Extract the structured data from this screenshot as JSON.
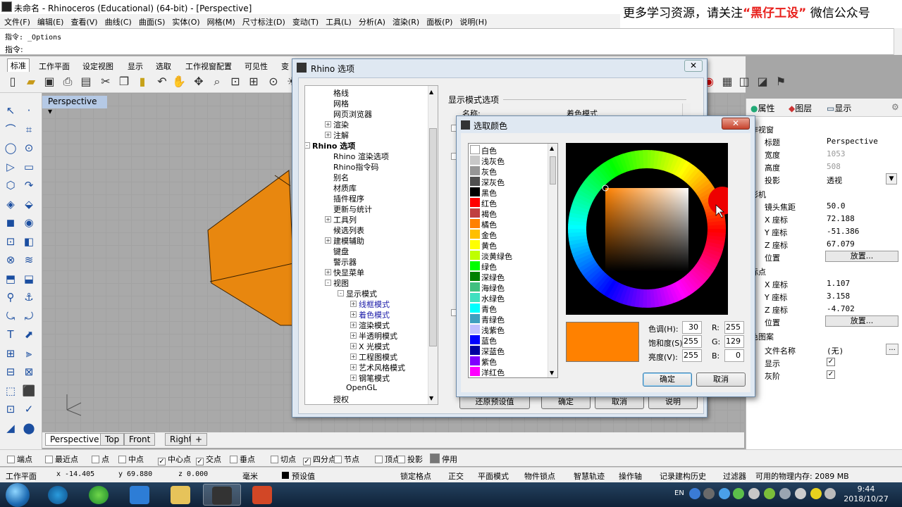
{
  "title_bar": {
    "title": "未命名 - Rhinoceros (Educational) (64-bit) - [Perspective]"
  },
  "banner": {
    "prefix": "更多学习资源，请关注",
    "highlight": "“黑仔工设”",
    "suffix": "微信公众号"
  },
  "menu": [
    "文件(F)",
    "编辑(E)",
    "查看(V)",
    "曲线(C)",
    "曲面(S)",
    "实体(O)",
    "网格(M)",
    "尺寸标注(D)",
    "变动(T)",
    "工具(L)",
    "分析(A)",
    "渲染(R)",
    "面板(P)",
    "说明(H)"
  ],
  "command": {
    "history": "指令: _Options",
    "prompt": "指令:"
  },
  "toolbar_tabs": [
    "标准",
    "工作平面",
    "设定视图",
    "显示",
    "选取",
    "工作视窗配置",
    "可见性",
    "变"
  ],
  "viewport": {
    "label": "Perspective"
  },
  "view_tabs": [
    "Perspective",
    "Top",
    "Front",
    "Right",
    "+"
  ],
  "osnaps": [
    {
      "label": "端点",
      "checked": false
    },
    {
      "label": "最近点",
      "checked": false
    },
    {
      "label": "点",
      "checked": false
    },
    {
      "label": "中点",
      "checked": false
    },
    {
      "label": "中心点",
      "checked": true
    },
    {
      "label": "交点",
      "checked": true
    },
    {
      "label": "垂点",
      "checked": false
    },
    {
      "label": "切点",
      "checked": false
    },
    {
      "label": "四分点",
      "checked": true
    },
    {
      "label": "节点",
      "checked": false
    },
    {
      "label": "顶点",
      "checked": false
    },
    {
      "label": "投影",
      "checked": false
    },
    {
      "label": "停用",
      "checked": false
    }
  ],
  "status": {
    "cplane": "工作平面",
    "x": "x -14.405",
    "y": "y 69.880",
    "z": "z 0.000",
    "unit": "毫米",
    "layer": "预设值",
    "items": [
      "锁定格点",
      "正交",
      "平面模式",
      "物件锁点",
      "智慧轨迹",
      "操作轴",
      "记录建构历史",
      "过滤器"
    ],
    "memory": "可用的物理内存: 2089 MB"
  },
  "taskbar": {
    "time": "9:44",
    "date": "2018/10/27",
    "lang": "EN"
  },
  "right_panel": {
    "tabs": [
      "属性",
      "图层",
      "显示"
    ],
    "rows": [
      {
        "type": "sec",
        "k": "作视窗"
      },
      {
        "k": "标题",
        "v": "Perspective"
      },
      {
        "k": "宽度",
        "v": "1053",
        "dim": true
      },
      {
        "k": "高度",
        "v": "508",
        "dim": true
      },
      {
        "k": "投影",
        "v": "透视",
        "dropdown": true
      },
      {
        "type": "sec",
        "k": "影机"
      },
      {
        "k": "镜头焦距",
        "v": "50.0"
      },
      {
        "k": "X 座标",
        "v": "72.188"
      },
      {
        "k": "Y 座标",
        "v": "-51.386"
      },
      {
        "k": "Z 座标",
        "v": "67.079"
      },
      {
        "k": "位置",
        "btn": "放置..."
      },
      {
        "type": "sec",
        "k": "标点"
      },
      {
        "k": "X 座标",
        "v": "1.107"
      },
      {
        "k": "Y 座标",
        "v": "3.158"
      },
      {
        "k": "Z 座标",
        "v": "-4.702"
      },
      {
        "k": "位置",
        "btn": "放置..."
      },
      {
        "type": "sec",
        "k": "色图案"
      },
      {
        "k": "文件名称",
        "v": "(无)"
      },
      {
        "k": "显示",
        "check": true
      },
      {
        "k": "灰阶",
        "check": true
      }
    ]
  },
  "options_dialog": {
    "title": "Rhino 选项",
    "section_label": "显示模式选项",
    "name_label": "名称:",
    "name_value": "着色模式",
    "bottom_buttons": [
      "还原预设值",
      "确定",
      "取消",
      "说明"
    ],
    "tree": [
      {
        "label": "格线",
        "indent": 2
      },
      {
        "label": "网格",
        "indent": 2
      },
      {
        "label": "网页浏览器",
        "indent": 2
      },
      {
        "label": "渲染",
        "indent": 2,
        "exp": "+"
      },
      {
        "label": "注解",
        "indent": 2,
        "exp": "+"
      },
      {
        "label": "Rhino 选项",
        "indent": 1,
        "exp": "-",
        "bold": true
      },
      {
        "label": "Rhino 渲染选项",
        "indent": 2
      },
      {
        "label": "Rhino指令码",
        "indent": 2
      },
      {
        "label": "别名",
        "indent": 2
      },
      {
        "label": "材质库",
        "indent": 2
      },
      {
        "label": "插件程序",
        "indent": 2
      },
      {
        "label": "更新与统计",
        "indent": 2
      },
      {
        "label": "工具列",
        "indent": 2,
        "exp": "+"
      },
      {
        "label": "候选列表",
        "indent": 2
      },
      {
        "label": "建模辅助",
        "indent": 2,
        "exp": "+"
      },
      {
        "label": "键盘",
        "indent": 2
      },
      {
        "label": "警示器",
        "indent": 2
      },
      {
        "label": "快显菜单",
        "indent": 2,
        "exp": "+"
      },
      {
        "label": "视图",
        "indent": 2,
        "exp": "-"
      },
      {
        "label": "显示模式",
        "indent": 3,
        "exp": "-"
      },
      {
        "label": "线框模式",
        "indent": 4,
        "exp": "+",
        "sel": true
      },
      {
        "label": "着色模式",
        "indent": 4,
        "exp": "+",
        "sel": true
      },
      {
        "label": "渲染模式",
        "indent": 4,
        "exp": "+"
      },
      {
        "label": "半透明模式",
        "indent": 4,
        "exp": "+"
      },
      {
        "label": "X 光模式",
        "indent": 4,
        "exp": "+"
      },
      {
        "label": "工程图模式",
        "indent": 4,
        "exp": "+"
      },
      {
        "label": "艺术风格模式",
        "indent": 4,
        "exp": "+"
      },
      {
        "label": "钢笔模式",
        "indent": 4,
        "exp": "+"
      },
      {
        "label": "OpenGL",
        "indent": 3
      },
      {
        "label": "授权",
        "indent": 2
      }
    ]
  },
  "color_dialog": {
    "title": "选取颜色",
    "colors": [
      {
        "name": "白色",
        "hex": "#ffffff"
      },
      {
        "name": "浅灰色",
        "hex": "#c8c8c8"
      },
      {
        "name": "灰色",
        "hex": "#969696"
      },
      {
        "name": "深灰色",
        "hex": "#505050"
      },
      {
        "name": "黑色",
        "hex": "#000000"
      },
      {
        "name": "红色",
        "hex": "#ff0000"
      },
      {
        "name": "褐色",
        "hex": "#c04040"
      },
      {
        "name": "橘色",
        "hex": "#ff8000"
      },
      {
        "name": "金色",
        "hex": "#ffbf00"
      },
      {
        "name": "黄色",
        "hex": "#ffff00"
      },
      {
        "name": "淡黄绿色",
        "hex": "#bfff00"
      },
      {
        "name": "绿色",
        "hex": "#00ff00"
      },
      {
        "name": "深绿色",
        "hex": "#008000"
      },
      {
        "name": "海绿色",
        "hex": "#40c080"
      },
      {
        "name": "水绿色",
        "hex": "#40e0c0"
      },
      {
        "name": "青色",
        "hex": "#00ffff"
      },
      {
        "name": "青绿色",
        "hex": "#40a0c0"
      },
      {
        "name": "浅紫色",
        "hex": "#c0c0ff"
      },
      {
        "name": "蓝色",
        "hex": "#0000ff"
      },
      {
        "name": "深蓝色",
        "hex": "#0000a0"
      },
      {
        "name": "紫色",
        "hex": "#8000ff"
      },
      {
        "name": "洋红色",
        "hex": "#ff00ff"
      }
    ],
    "hue_label": "色调(H):",
    "hue": "30",
    "sat_label": "饱和度(S):",
    "sat": "255",
    "val_label": "亮度(V):",
    "val": "255",
    "r_label": "R:",
    "r": "255",
    "g_label": "G:",
    "g": "129",
    "b_label": "B:",
    "b": "0",
    "preview_hex": "#ff8100",
    "ok": "确定",
    "cancel": "取消"
  },
  "colors": {
    "accent_orange": "#ff8100",
    "viewport_bg": "#a9a9a9",
    "dialog_frame": "#dfe8f2"
  }
}
